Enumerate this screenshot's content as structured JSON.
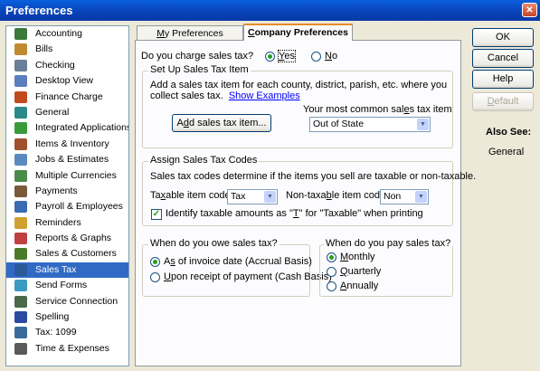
{
  "window": {
    "title": "Preferences",
    "close_glyph": "✕"
  },
  "sidebar": {
    "items": [
      {
        "label": "Accounting",
        "icon": "accounting-icon",
        "color": "#3a7a3a"
      },
      {
        "label": "Bills",
        "icon": "bills-icon",
        "color": "#c08a30"
      },
      {
        "label": "Checking",
        "icon": "checking-icon",
        "color": "#6a7f9a"
      },
      {
        "label": "Desktop View",
        "icon": "desktop-view-icon",
        "color": "#5a7fc0"
      },
      {
        "label": "Finance Charge",
        "icon": "finance-charge-icon",
        "color": "#c04a20"
      },
      {
        "label": "General",
        "icon": "general-icon",
        "color": "#2a8a8a"
      },
      {
        "label": "Integrated Applications",
        "icon": "integrated-applications-icon",
        "color": "#3a9a3a"
      },
      {
        "label": "Items & Inventory",
        "icon": "items-inventory-icon",
        "color": "#a0502a"
      },
      {
        "label": "Jobs & Estimates",
        "icon": "jobs-estimates-icon",
        "color": "#5a8ac0"
      },
      {
        "label": "Multiple Currencies",
        "icon": "multiple-currencies-icon",
        "color": "#4a8a4a"
      },
      {
        "label": "Payments",
        "icon": "payments-icon",
        "color": "#7a5a3a"
      },
      {
        "label": "Payroll & Employees",
        "icon": "payroll-employees-icon",
        "color": "#3a6ab0"
      },
      {
        "label": "Reminders",
        "icon": "reminders-icon",
        "color": "#d0a030"
      },
      {
        "label": "Reports & Graphs",
        "icon": "reports-graphs-icon",
        "color": "#c04040"
      },
      {
        "label": "Sales & Customers",
        "icon": "sales-customers-icon",
        "color": "#4a7a2a"
      },
      {
        "label": "Sales Tax",
        "icon": "sales-tax-icon",
        "color": "#2a5a9a"
      },
      {
        "label": "Send Forms",
        "icon": "send-forms-icon",
        "color": "#3a9ac0"
      },
      {
        "label": "Service Connection",
        "icon": "service-connection-icon",
        "color": "#4a6a4a"
      },
      {
        "label": "Spelling",
        "icon": "spelling-icon",
        "color": "#2a4aa0"
      },
      {
        "label": "Tax: 1099",
        "icon": "tax-1099-icon",
        "color": "#3a6a9a"
      },
      {
        "label": "Time & Expenses",
        "icon": "time-expenses-icon",
        "color": "#5a5a5a"
      }
    ],
    "selected_index": 15
  },
  "tabs": {
    "my_preferences": {
      "pre": "",
      "ul": "M",
      "post": "y Preferences"
    },
    "company_preferences": {
      "pre": "",
      "ul": "C",
      "post": "ompany Preferences"
    }
  },
  "charge_question": {
    "label": "Do you charge sales tax?",
    "yes": {
      "pre": "",
      "ul": "Y",
      "post": "es",
      "checked": true
    },
    "no": {
      "pre": "",
      "ul": "N",
      "post": "o",
      "checked": false
    }
  },
  "setup_group": {
    "title": "Set Up Sales Tax Item",
    "line1": "Add a sales tax item for each county, district, parish, etc. where you",
    "line2": "collect sales tax.",
    "link": "Show Examples",
    "add_button": {
      "pre": "A",
      "ul": "d",
      "post": "d sales tax item..."
    },
    "common_label": {
      "pre": "Your most common sal",
      "ul": "e",
      "post": "s tax item"
    },
    "common_value": "Out of State"
  },
  "codes_group": {
    "title": "Assign Sales Tax Codes",
    "description": "Sales tax codes determine if the items you sell are taxable or non-taxable.",
    "taxable_label": {
      "pre": "Ta",
      "ul": "x",
      "post": "able item code"
    },
    "taxable_value": "Tax",
    "nontaxable_label": {
      "pre": "Non-taxa",
      "ul": "b",
      "post": "le item code"
    },
    "nontaxable_value": "Non",
    "identify": {
      "pre": "Identify taxable amounts as \"",
      "ul": "T",
      "post": "\" for \"Taxable\" when printing",
      "checked": true
    }
  },
  "owe_group": {
    "title": "When do you owe sales tax?",
    "accrual": {
      "pre": "A",
      "ul": "s",
      "post": " of invoice date (Accrual Basis)",
      "checked": true
    },
    "cash": {
      "pre": "",
      "ul": "U",
      "post": "pon receipt of payment (Cash Basis)",
      "checked": false
    }
  },
  "pay_group": {
    "title": "When do you pay sales tax?",
    "monthly": {
      "pre": "",
      "ul": "M",
      "post": "onthly",
      "checked": true
    },
    "quarterly": {
      "pre": "",
      "ul": "Q",
      "post": "uarterly",
      "checked": false
    },
    "annually": {
      "pre": "",
      "ul": "A",
      "post": "nnually",
      "checked": false
    }
  },
  "buttons": {
    "ok": "OK",
    "cancel": "Cancel",
    "help": "Help",
    "default": {
      "pre": "",
      "ul": "D",
      "post": "efault"
    }
  },
  "also_see": {
    "title": "Also See:",
    "items": [
      "General"
    ]
  },
  "colors": {
    "selected_row": "#316ac5",
    "radio_dot": "#21a121",
    "titlebar": "#0a5fdc"
  }
}
